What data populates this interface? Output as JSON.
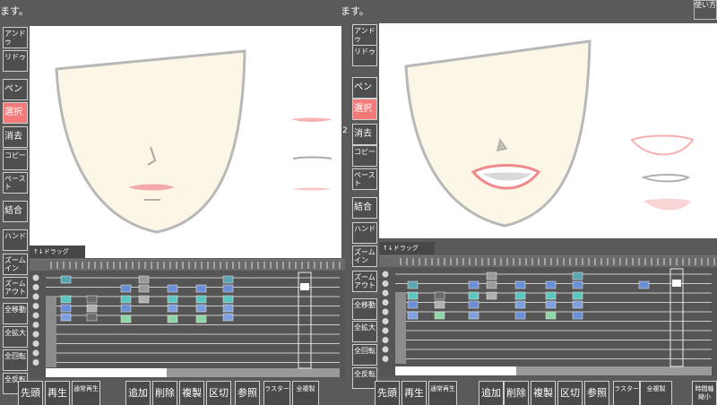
{
  "colors": {
    "active": "#f47a7a",
    "bg": "#5a5a5a",
    "canvas": "#ffffff",
    "face": "#fbf6e6"
  },
  "left": {
    "status": "ます。",
    "tools": [
      "アンドゥ",
      "リドゥ",
      "ペン",
      "選択",
      "消去",
      "コピー",
      "ペースト",
      "結合",
      "ハンド",
      "ズーム イン",
      "ズーム アウト",
      "全移動",
      "全拡大",
      "全回転",
      "全反転"
    ],
    "timeline_label": "↑↓ドラッグ",
    "bottom": [
      "先頭",
      "再生",
      "通常再生",
      "追加",
      "削除",
      "複製",
      "区切",
      "参照",
      "ラスター",
      "全複製"
    ]
  },
  "right": {
    "status": "ます。",
    "help": "使い方",
    "tools": [
      "アンドゥ",
      "リドゥ",
      "ペン",
      "選択",
      "消去",
      "コピー",
      "ペースト",
      "結合",
      "ハンド",
      "ズーム イン",
      "ズーム アウト",
      "全移動",
      "全拡大",
      "全回転",
      "全反転"
    ],
    "timeline_label": "↑↓ドラッグ",
    "bottom": [
      "先頭",
      "再生",
      "通常再生",
      "追加",
      "削除",
      "複製",
      "区切",
      "参照",
      "ラスター",
      "全複製",
      "時間軸縮小"
    ],
    "edge_mark": "2"
  }
}
